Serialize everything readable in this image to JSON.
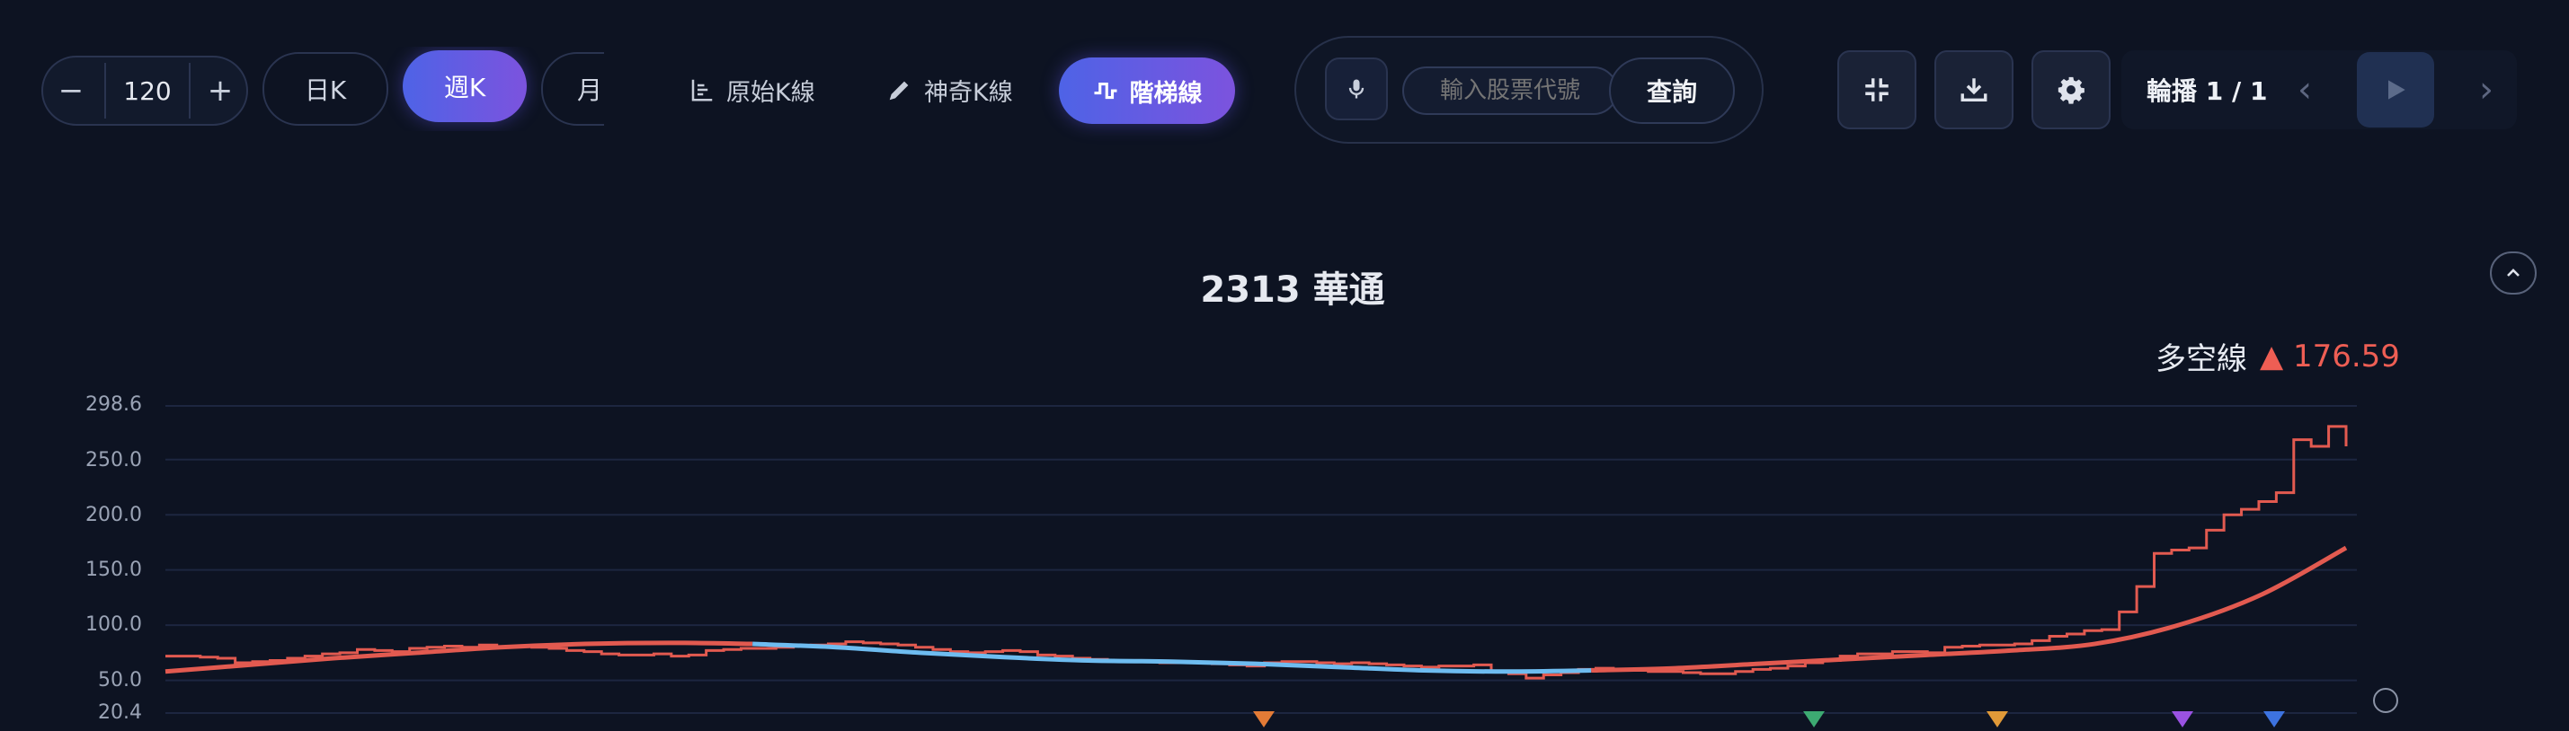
{
  "toolbar": {
    "stepper": {
      "minus": "−",
      "value": "120",
      "plus": "+"
    },
    "periods": [
      {
        "label": "日K",
        "active": false
      },
      {
        "label": "週K",
        "active": true
      },
      {
        "label": "月",
        "active": false
      }
    ],
    "modes": [
      {
        "label": "原始K線",
        "icon": "bar-chart-icon",
        "active": false
      },
      {
        "label": "神奇K線",
        "icon": "pencil-icon",
        "active": false
      },
      {
        "label": "階梯線",
        "icon": "step-line-icon",
        "active": true
      }
    ],
    "search": {
      "placeholder": "輸入股票代號",
      "query_label": "查詢",
      "mic_icon": "mic-icon"
    },
    "icons": [
      "collapse-icon",
      "download-icon",
      "gear-icon"
    ],
    "rotation": {
      "label": "輪播 1 / 1",
      "prev": "‹",
      "next": "›"
    }
  },
  "chart_data": {
    "type": "line",
    "title": "2313 華通",
    "legend": {
      "name": "多空線",
      "marker": "▲",
      "value": "176.59",
      "color": "#ee5e54"
    },
    "y_ticks": [
      "298.6",
      "250.0",
      "200.0",
      "150.0",
      "100.0",
      "50.0",
      "20.4"
    ],
    "ylim": [
      20.4,
      298.6
    ],
    "grid": true,
    "series": [
      {
        "style": "step",
        "color_up": "#e25a50",
        "color_mid": "#6ebcf0",
        "color_down": "#63c35a",
        "values": [
          72,
          72,
          71,
          70,
          66,
          67,
          68,
          70,
          72,
          74,
          75,
          78,
          77,
          76,
          79,
          80,
          81,
          80,
          82,
          80,
          81,
          80,
          79,
          77,
          76,
          74,
          73,
          73,
          74,
          72,
          73,
          77,
          78,
          79,
          79,
          80,
          81,
          82,
          83,
          85,
          84,
          83,
          82,
          80,
          78,
          76,
          75,
          76,
          77,
          76,
          73,
          72,
          70,
          69,
          68,
          67,
          67,
          66,
          66,
          66,
          65,
          64,
          63,
          66,
          67,
          67,
          66,
          65,
          66,
          65,
          64,
          63,
          62,
          63,
          63,
          64,
          58,
          56,
          52,
          55,
          57,
          60,
          61,
          60,
          59,
          58,
          58,
          57,
          56,
          56,
          58,
          60,
          61,
          63,
          66,
          68,
          72,
          74,
          74,
          76,
          76,
          75,
          80,
          81,
          82,
          82,
          83,
          86,
          90,
          92,
          95,
          96,
          112,
          135,
          165,
          168,
          170,
          186,
          200,
          205,
          212,
          220,
          268,
          262,
          280,
          262
        ]
      },
      {
        "style": "smooth",
        "values": [
          58,
          64,
          70,
          75,
          80,
          83,
          84,
          83,
          80,
          75,
          71,
          68,
          67,
          65,
          62,
          59,
          58,
          59,
          61,
          65,
          69,
          73,
          77,
          83,
          100,
          128,
          170
        ]
      }
    ],
    "markers": [
      {
        "shape": "triangle-down",
        "color": "#e37b36"
      },
      {
        "shape": "triangle-down",
        "color": "#3daa72"
      },
      {
        "shape": "triangle-down",
        "color": "#e19a38"
      },
      {
        "shape": "triangle-down",
        "color": "#9a52e2"
      },
      {
        "shape": "triangle-down",
        "color": "#3d73e0"
      }
    ]
  }
}
